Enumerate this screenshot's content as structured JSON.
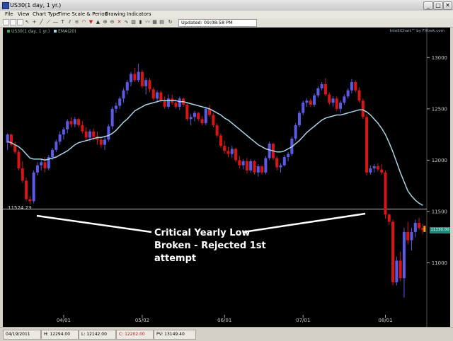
{
  "window": {
    "title": "US30(1 day, 1 yr.)",
    "min": "_",
    "max": "□",
    "close": "✕"
  },
  "menu": [
    "File",
    "View",
    "Chart Type",
    "Time Scale & Period",
    "Drawing",
    "Indicators"
  ],
  "toolbar": {
    "updated": "Updated: 09:08:58 PM"
  },
  "legend": {
    "series1": "US30(1 day, 1 yr.)",
    "series2": "EMA(20)"
  },
  "brand": "IntelliChart™ by FXtrek.com",
  "level": {
    "label": "11524.23",
    "value": 11524.23
  },
  "current_price": "11330.00",
  "annotation": {
    "line1": "Critical Yearly Low",
    "line2": "Broken - Rejected 1st",
    "line3": "attempt"
  },
  "status": {
    "date": "04/19/2011",
    "high": "H: 12294.00",
    "low": "L: 12142.00",
    "close": "C: 12202.00",
    "pv": "PV: 13149.40"
  },
  "colors": {
    "up": "#5a5ae6",
    "down": "#d81414",
    "ema": "#a8d4e6",
    "price_tag": "#1f8a78",
    "grid": "#ffffff"
  },
  "chart_data": {
    "type": "candlestick",
    "ylim": [
      10500,
      13250
    ],
    "yticks": [
      11000,
      11500,
      12000,
      12500,
      13000
    ],
    "xticks": [
      {
        "label": "04/01",
        "index": 15
      },
      {
        "label": "05/02",
        "index": 36
      },
      {
        "label": "06/01",
        "index": 58
      },
      {
        "label": "07/01",
        "index": 79
      },
      {
        "label": "08/01",
        "index": 101
      }
    ],
    "level_line": 11524.23,
    "candles": [
      [
        12170,
        12260,
        12100,
        12250
      ],
      [
        12250,
        12260,
        12130,
        12150
      ],
      [
        12150,
        12180,
        12060,
        12080
      ],
      [
        12080,
        12100,
        11900,
        11920
      ],
      [
        11920,
        11990,
        11780,
        11800
      ],
      [
        11800,
        11830,
        11600,
        11620
      ],
      [
        11620,
        11650,
        11570,
        11600
      ],
      [
        11600,
        11900,
        11580,
        11880
      ],
      [
        11880,
        11980,
        11850,
        11950
      ],
      [
        11950,
        12010,
        11900,
        11980
      ],
      [
        11980,
        12030,
        11880,
        11920
      ],
      [
        11920,
        12050,
        11900,
        12030
      ],
      [
        12030,
        12120,
        12000,
        12100
      ],
      [
        12100,
        12200,
        12080,
        12180
      ],
      [
        12180,
        12280,
        12150,
        12250
      ],
      [
        12250,
        12320,
        12200,
        12300
      ],
      [
        12300,
        12400,
        12260,
        12380
      ],
      [
        12380,
        12420,
        12320,
        12350
      ],
      [
        12350,
        12420,
        12320,
        12400
      ],
      [
        12400,
        12410,
        12320,
        12340
      ],
      [
        12340,
        12380,
        12260,
        12280
      ],
      [
        12280,
        12320,
        12190,
        12220
      ],
      [
        12220,
        12300,
        12180,
        12280
      ],
      [
        12280,
        12310,
        12200,
        12230
      ],
      [
        12230,
        12280,
        12150,
        12200
      ],
      [
        12200,
        12230,
        12120,
        12150
      ],
      [
        12150,
        12230,
        12100,
        12200
      ],
      [
        12200,
        12350,
        12180,
        12330
      ],
      [
        12330,
        12520,
        12300,
        12500
      ],
      [
        12500,
        12560,
        12460,
        12530
      ],
      [
        12530,
        12620,
        12500,
        12600
      ],
      [
        12600,
        12700,
        12560,
        12680
      ],
      [
        12680,
        12780,
        12640,
        12760
      ],
      [
        12760,
        12860,
        12720,
        12840
      ],
      [
        12840,
        12900,
        12760,
        12780
      ],
      [
        12780,
        12940,
        12760,
        12860
      ],
      [
        12860,
        12880,
        12700,
        12720
      ],
      [
        12720,
        12800,
        12640,
        12780
      ],
      [
        12780,
        12800,
        12660,
        12690
      ],
      [
        12690,
        12710,
        12580,
        12600
      ],
      [
        12600,
        12680,
        12560,
        12660
      ],
      [
        12660,
        12680,
        12560,
        12580
      ],
      [
        12580,
        12620,
        12500,
        12520
      ],
      [
        12520,
        12640,
        12500,
        12600
      ],
      [
        12600,
        12640,
        12540,
        12560
      ],
      [
        12560,
        12590,
        12500,
        12520
      ],
      [
        12520,
        12620,
        12490,
        12600
      ],
      [
        12600,
        12610,
        12520,
        12540
      ],
      [
        12540,
        12560,
        12380,
        12400
      ],
      [
        12400,
        12450,
        12340,
        12420
      ],
      [
        12420,
        12480,
        12380,
        12460
      ],
      [
        12460,
        12470,
        12380,
        12400
      ],
      [
        12400,
        12430,
        12340,
        12360
      ],
      [
        12360,
        12520,
        12340,
        12500
      ],
      [
        12500,
        12540,
        12420,
        12440
      ],
      [
        12440,
        12460,
        12320,
        12340
      ],
      [
        12340,
        12360,
        12220,
        12240
      ],
      [
        12240,
        12260,
        12120,
        12140
      ],
      [
        12140,
        12190,
        12060,
        12090
      ],
      [
        12090,
        12130,
        12030,
        12060
      ],
      [
        12060,
        12140,
        12020,
        12110
      ],
      [
        12110,
        12120,
        11980,
        12000
      ],
      [
        12000,
        12040,
        11920,
        11950
      ],
      [
        11950,
        12010,
        11910,
        11990
      ],
      [
        11990,
        12020,
        11870,
        11900
      ],
      [
        11900,
        12010,
        11880,
        11990
      ],
      [
        11990,
        12000,
        11860,
        11880
      ],
      [
        11880,
        11960,
        11840,
        11940
      ],
      [
        11940,
        11950,
        11860,
        11880
      ],
      [
        11880,
        12040,
        11860,
        12020
      ],
      [
        12020,
        12180,
        12000,
        12160
      ],
      [
        12160,
        12170,
        12000,
        12020
      ],
      [
        12020,
        12040,
        11900,
        11930
      ],
      [
        11930,
        11970,
        11880,
        11950
      ],
      [
        11950,
        12050,
        11940,
        12030
      ],
      [
        12030,
        12080,
        11990,
        12060
      ],
      [
        12060,
        12230,
        12040,
        12210
      ],
      [
        12210,
        12360,
        12190,
        12340
      ],
      [
        12340,
        12480,
        12320,
        12460
      ],
      [
        12460,
        12580,
        12440,
        12560
      ],
      [
        12560,
        12600,
        12520,
        12580
      ],
      [
        12580,
        12600,
        12520,
        12540
      ],
      [
        12540,
        12650,
        12520,
        12630
      ],
      [
        12630,
        12720,
        12610,
        12700
      ],
      [
        12700,
        12760,
        12680,
        12740
      ],
      [
        12740,
        12800,
        12620,
        12640
      ],
      [
        12640,
        12660,
        12540,
        12560
      ],
      [
        12560,
        12620,
        12520,
        12600
      ],
      [
        12600,
        12620,
        12480,
        12500
      ],
      [
        12500,
        12580,
        12460,
        12560
      ],
      [
        12560,
        12640,
        12540,
        12620
      ],
      [
        12620,
        12700,
        12600,
        12680
      ],
      [
        12680,
        12790,
        12650,
        12760
      ],
      [
        12760,
        12780,
        12660,
        12680
      ],
      [
        12680,
        12710,
        12560,
        12580
      ],
      [
        12580,
        12600,
        12400,
        12420
      ],
      [
        12420,
        12450,
        11850,
        11880
      ],
      [
        11880,
        11950,
        11860,
        11920
      ],
      [
        11920,
        11960,
        11880,
        11940
      ],
      [
        11940,
        11970,
        11890,
        11910
      ],
      [
        11910,
        11960,
        11860,
        11880
      ],
      [
        11880,
        11900,
        11430,
        11470
      ],
      [
        11470,
        11480,
        11370,
        11400
      ],
      [
        11400,
        11420,
        10780,
        10810
      ],
      [
        10810,
        11060,
        10780,
        11020
      ],
      [
        11020,
        11110,
        10820,
        10850
      ],
      [
        10850,
        11340,
        10660,
        11300
      ],
      [
        11300,
        11400,
        11180,
        11220
      ],
      [
        11220,
        11340,
        11120,
        11300
      ],
      [
        11300,
        11420,
        11250,
        11390
      ],
      [
        11390,
        11440,
        11320,
        11340
      ],
      [
        11340,
        11380,
        11280,
        11320
      ]
    ],
    "ema": [
      12180,
      12170,
      12150,
      12130,
      12100,
      12060,
      12020,
      12010,
      12010,
      12010,
      12000,
      12010,
      12020,
      12030,
      12050,
      12070,
      12090,
      12120,
      12150,
      12170,
      12180,
      12190,
      12200,
      12210,
      12220,
      12220,
      12230,
      12240,
      12260,
      12290,
      12330,
      12370,
      12400,
      12440,
      12480,
      12500,
      12520,
      12540,
      12550,
      12560,
      12570,
      12580,
      12580,
      12580,
      12580,
      12580,
      12570,
      12570,
      12560,
      12550,
      12540,
      12530,
      12520,
      12510,
      12500,
      12480,
      12460,
      12440,
      12410,
      12390,
      12360,
      12330,
      12300,
      12270,
      12240,
      12210,
      12180,
      12150,
      12130,
      12110,
      12100,
      12090,
      12080,
      12080,
      12090,
      12110,
      12130,
      12160,
      12190,
      12230,
      12270,
      12300,
      12330,
      12360,
      12390,
      12410,
      12420,
      12430,
      12440,
      12440,
      12450,
      12460,
      12470,
      12480,
      12490,
      12490,
      12470,
      12440,
      12400,
      12360,
      12310,
      12250,
      12170,
      12080,
      11980,
      11880,
      11790,
      11700,
      11650,
      11610,
      11580,
      11560
    ]
  }
}
